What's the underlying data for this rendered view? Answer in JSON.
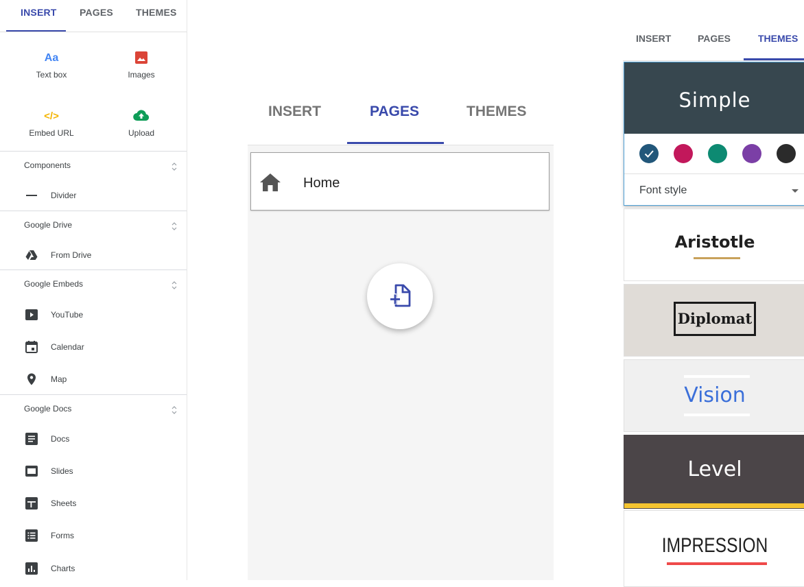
{
  "insert_panel": {
    "tabs": [
      "INSERT",
      "PAGES",
      "THEMES"
    ],
    "active_tab": "INSERT",
    "quick_items": [
      {
        "label": "Text box",
        "icon": "text-box-icon",
        "glyph": "Aa",
        "color": "#4285f4"
      },
      {
        "label": "Images",
        "icon": "image-icon",
        "color": "#db4437"
      },
      {
        "label": "Embed URL",
        "icon": "embed-code-icon",
        "glyph": "</>",
        "color": "#f4b400"
      },
      {
        "label": "Upload",
        "icon": "upload-cloud-icon",
        "color": "#0f9d58"
      }
    ],
    "sections": [
      {
        "title": "Components",
        "items": [
          {
            "label": "Divider",
            "icon": "divider-icon"
          }
        ]
      },
      {
        "title": "Google Drive",
        "items": [
          {
            "label": "From Drive",
            "icon": "drive-icon"
          }
        ]
      },
      {
        "title": "Google Embeds",
        "items": [
          {
            "label": "YouTube",
            "icon": "youtube-icon"
          },
          {
            "label": "Calendar",
            "icon": "calendar-icon"
          },
          {
            "label": "Map",
            "icon": "map-pin-icon"
          }
        ]
      },
      {
        "title": "Google Docs",
        "items": [
          {
            "label": "Docs",
            "icon": "docs-icon"
          },
          {
            "label": "Slides",
            "icon": "slides-icon"
          },
          {
            "label": "Sheets",
            "icon": "sheets-icon"
          },
          {
            "label": "Forms",
            "icon": "forms-icon"
          },
          {
            "label": "Charts",
            "icon": "charts-icon"
          }
        ]
      }
    ]
  },
  "pages_panel": {
    "tabs": [
      "INSERT",
      "PAGES",
      "THEMES"
    ],
    "active_tab": "PAGES",
    "pages": [
      {
        "title": "Home",
        "icon": "home-icon"
      }
    ],
    "add_page_icon": "add-page-icon"
  },
  "themes_panel": {
    "tabs": [
      "INSERT",
      "PAGES",
      "THEMES"
    ],
    "active_tab": "THEMES",
    "selected_theme": {
      "name": "Simple",
      "header_color": "#37474f",
      "color_options": [
        "#22577a",
        "#c2185b",
        "#0d8a72",
        "#7b3fa6",
        "#2b2b2b"
      ],
      "selected_color": "#22577a",
      "font_style_label": "Font style"
    },
    "themes": [
      {
        "name": "Aristotle",
        "background": "#ffffff",
        "accent": "#c8a15a"
      },
      {
        "name": "Diplomat",
        "background": "#e0dcd7",
        "accent": "#1a1a1a"
      },
      {
        "name": "Vision",
        "background": "#f0f0f0",
        "accent": "#3b6fd9"
      },
      {
        "name": "Level",
        "background": "#4b4548",
        "accent": "#f4c430"
      },
      {
        "name": "IMPRESSION",
        "background": "#ffffff",
        "accent": "#ef4a4a"
      }
    ]
  }
}
